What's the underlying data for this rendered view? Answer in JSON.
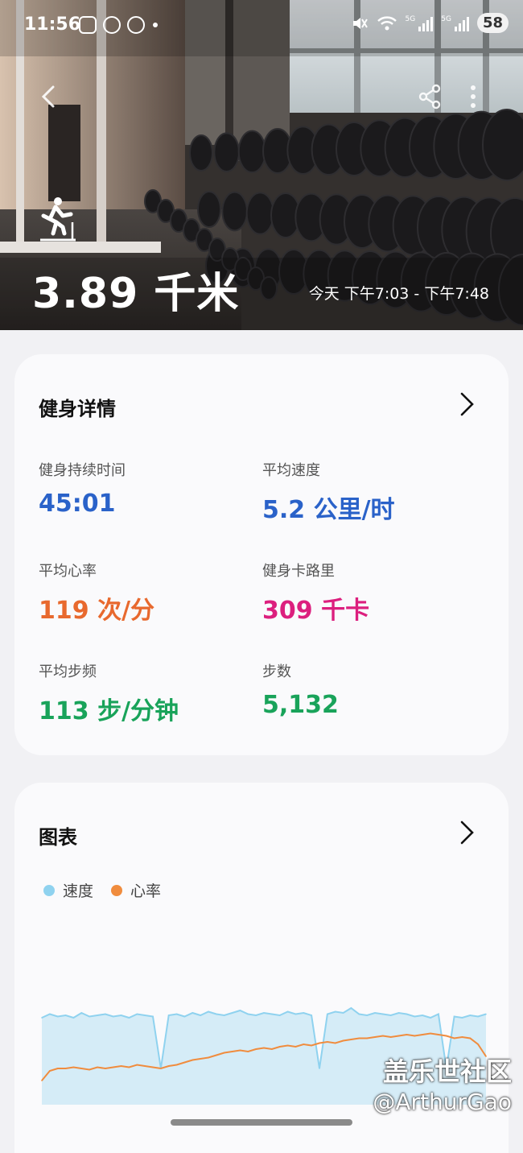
{
  "status_bar": {
    "time": "11:56",
    "battery": "58",
    "sig1_label": "5G",
    "sig2_label": "5G"
  },
  "hero": {
    "distance": "3.89 千米",
    "time_range": "今天 下午7:03 - 下午7:48",
    "icons": [
      "back-icon",
      "share-icon",
      "more-icon",
      "running-icon"
    ]
  },
  "details": {
    "title": "健身详情",
    "metrics": [
      {
        "label": "健身持续时间",
        "value": "45:01",
        "color": "#2a62c9"
      },
      {
        "label": "平均速度",
        "value": "5.2 公里/时",
        "color": "#2a62c9"
      },
      {
        "label": "平均心率",
        "value": "119 次/分",
        "color": "#e8692e"
      },
      {
        "label": "健身卡路里",
        "value": "309 千卡",
        "color": "#dc1f7e"
      },
      {
        "label": "平均步频",
        "value": "113 步/分钟",
        "color": "#19a35a"
      },
      {
        "label": "步数",
        "value": "5,132",
        "color": "#19a35a"
      }
    ]
  },
  "chart_card": {
    "title": "图表",
    "legend": [
      {
        "name": "速度",
        "color": "#8fd2ef"
      },
      {
        "name": "心率",
        "color": "#f08c3e"
      }
    ]
  },
  "chart_data": {
    "type": "line",
    "series": [
      {
        "name": "速度",
        "values": [
          0.72,
          0.75,
          0.73,
          0.74,
          0.72,
          0.76,
          0.73,
          0.74,
          0.75,
          0.73,
          0.74,
          0.72,
          0.75,
          0.74,
          0.73,
          0.3,
          0.74,
          0.75,
          0.73,
          0.76,
          0.74,
          0.77,
          0.75,
          0.74,
          0.76,
          0.78,
          0.75,
          0.74,
          0.76,
          0.75,
          0.74,
          0.77,
          0.75,
          0.76,
          0.74,
          0.3,
          0.75,
          0.77,
          0.76,
          0.8,
          0.75,
          0.74,
          0.76,
          0.75,
          0.74,
          0.76,
          0.75,
          0.73,
          0.74,
          0.72,
          0.75,
          0.3,
          0.73,
          0.72,
          0.74,
          0.73,
          0.75
        ]
      },
      {
        "name": "心率",
        "values": [
          0.2,
          0.28,
          0.3,
          0.3,
          0.31,
          0.3,
          0.29,
          0.31,
          0.3,
          0.31,
          0.32,
          0.31,
          0.33,
          0.32,
          0.31,
          0.3,
          0.32,
          0.33,
          0.35,
          0.37,
          0.38,
          0.39,
          0.41,
          0.43,
          0.44,
          0.45,
          0.44,
          0.46,
          0.47,
          0.46,
          0.48,
          0.49,
          0.48,
          0.5,
          0.49,
          0.51,
          0.52,
          0.51,
          0.53,
          0.54,
          0.55,
          0.55,
          0.56,
          0.57,
          0.56,
          0.57,
          0.58,
          0.57,
          0.58,
          0.59,
          0.58,
          0.57,
          0.55,
          0.56,
          0.55,
          0.5,
          0.4
        ]
      }
    ]
  },
  "watermark": {
    "line1": "盖乐世社区",
    "line2": "@ArthurGao"
  }
}
